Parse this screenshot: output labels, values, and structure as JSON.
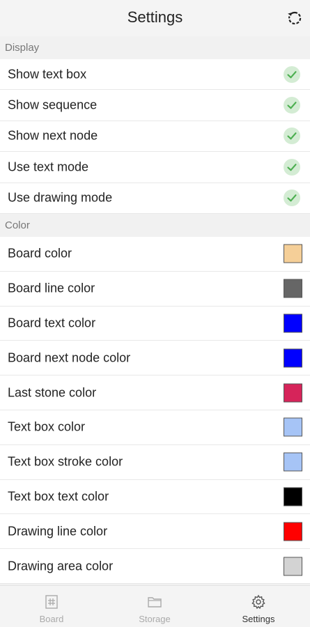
{
  "header": {
    "title": "Settings",
    "reset_icon": "refresh-icon"
  },
  "display": {
    "section_label": "Display",
    "items": [
      {
        "label": "Show text box",
        "checked": true
      },
      {
        "label": "Show sequence",
        "checked": true
      },
      {
        "label": "Show next node",
        "checked": true
      },
      {
        "label": "Use text mode",
        "checked": true
      },
      {
        "label": "Use drawing mode",
        "checked": true
      }
    ]
  },
  "color": {
    "section_label": "Color",
    "items": [
      {
        "label": "Board color",
        "swatch": "#f5cf98"
      },
      {
        "label": "Board line color",
        "swatch": "#666666"
      },
      {
        "label": "Board text color",
        "swatch": "#0000ff"
      },
      {
        "label": "Board next node color",
        "swatch": "#0000ff"
      },
      {
        "label": "Last stone color",
        "swatch": "#d6245a"
      },
      {
        "label": "Text box color",
        "swatch": "#a6c4f6"
      },
      {
        "label": "Text box stroke color",
        "swatch": "#a6c4f6"
      },
      {
        "label": "Text box text color",
        "swatch": "#000000"
      },
      {
        "label": "Drawing line color",
        "swatch": "#ff0000"
      },
      {
        "label": "Drawing area color",
        "swatch": "#d3d3d3"
      }
    ]
  },
  "nav": {
    "items": [
      {
        "label": "Board",
        "icon": "grid-icon",
        "active": false
      },
      {
        "label": "Storage",
        "icon": "folder-icon",
        "active": false
      },
      {
        "label": "Settings",
        "icon": "gear-icon",
        "active": true
      }
    ]
  },
  "colors": {
    "check_bg": "#d4ecd4",
    "check_mark": "#4caf50"
  }
}
